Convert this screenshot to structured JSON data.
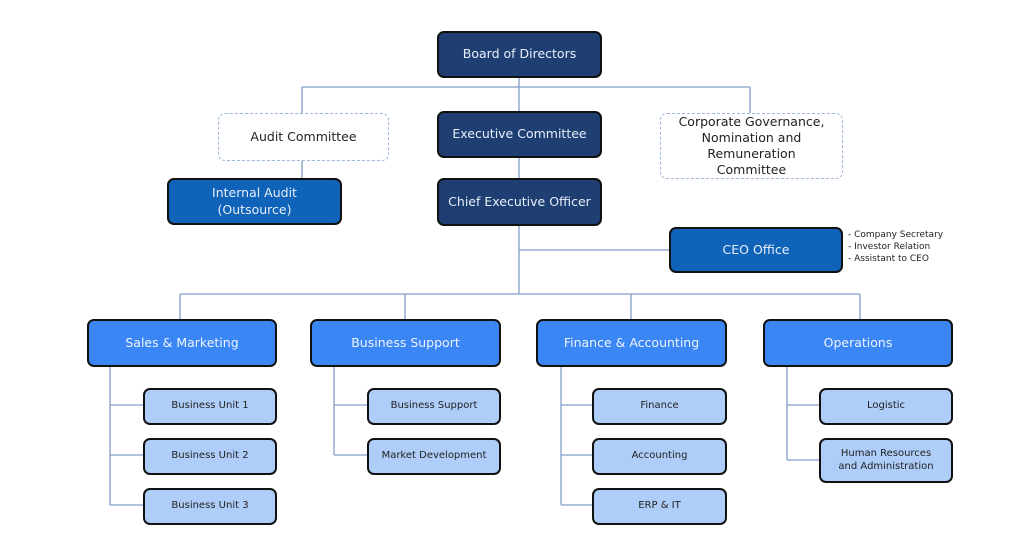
{
  "board": "Board of Directors",
  "audit_committee": "Audit Committee",
  "executive_committee": "Executive Committee",
  "governance_committee": "Corporate Governance, Nomination and Remuneration Committee",
  "internal_audit": "Internal Audit (Outsource)",
  "ceo": "Chief Executive Officer",
  "ceo_office": {
    "label": "CEO Office",
    "notes": [
      "- Company Secretary",
      "- Investor Relation",
      "- Assistant to CEO"
    ]
  },
  "divisions": [
    {
      "label": "Sales & Marketing",
      "units": [
        "Business Unit 1",
        "Business Unit 2",
        "Business Unit 3"
      ]
    },
    {
      "label": "Business Support",
      "units": [
        "Business Support",
        "Market Development"
      ]
    },
    {
      "label": "Finance & Accounting",
      "units": [
        "Finance",
        "Accounting",
        "ERP & IT"
      ]
    },
    {
      "label": "Operations",
      "units": [
        "Logistic",
        "Human Resources and Administration"
      ]
    }
  ],
  "colors": {
    "executive": "#1f3f73",
    "ceo_office": "#0f63b8",
    "division": "#3a86f5",
    "unit": "#aecdf8",
    "connector": "#7f9fc9"
  }
}
